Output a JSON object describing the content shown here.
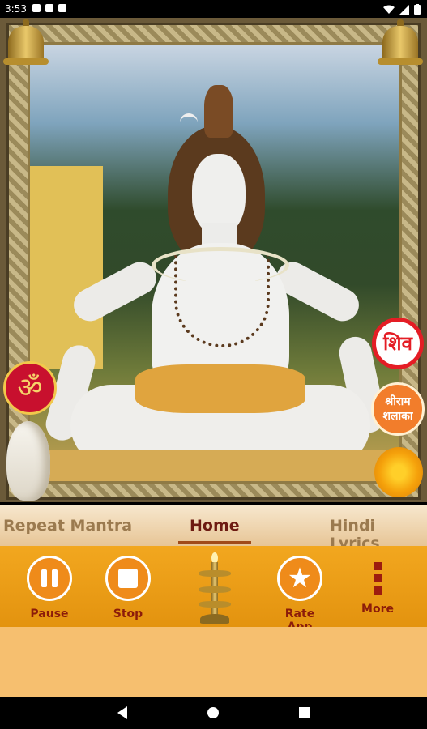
{
  "status": {
    "time": "3:53"
  },
  "overlays": {
    "om_symbol": "ॐ",
    "shiv_label": "शिव",
    "shalaka_line1": "श्रीराम",
    "shalaka_line2": "शलाका"
  },
  "tabs": [
    {
      "label": "Repeat Mantra",
      "active": false
    },
    {
      "label": "Home",
      "active": true
    },
    {
      "label": "Hindi Lyrics",
      "active": false
    }
  ],
  "controls": {
    "pause_label": "Pause",
    "stop_label": "Stop",
    "rate_label": "Rate App",
    "more_label": "More"
  },
  "colors": {
    "accent": "#ef8b1a",
    "label_red": "#8c1c0a",
    "shiv_red": "#e41d25"
  }
}
